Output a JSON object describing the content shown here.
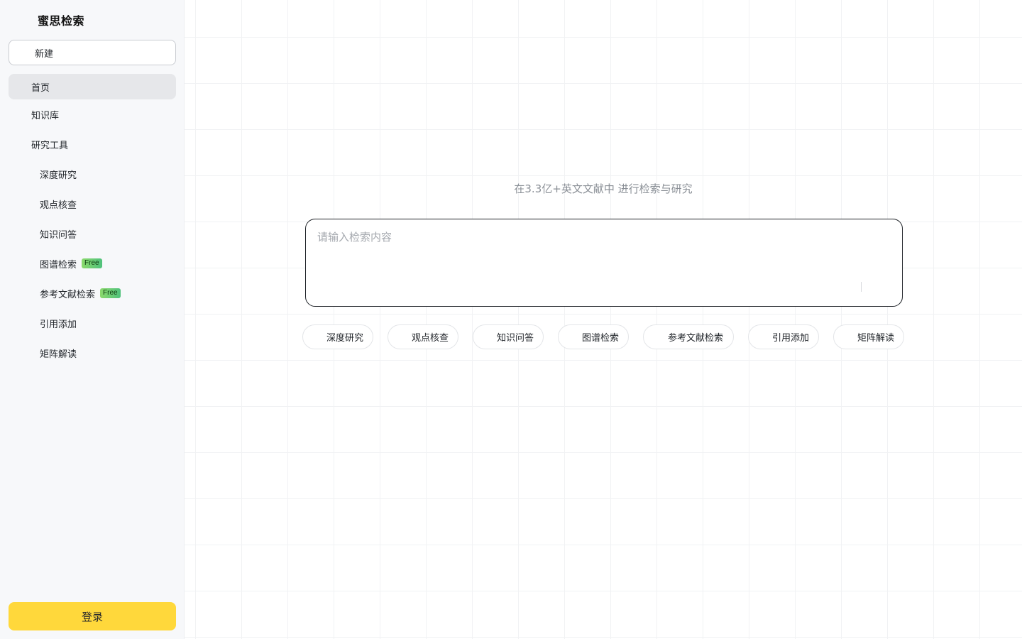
{
  "sidebar": {
    "brand": "蜜思检索",
    "new_label": "新建",
    "items": [
      {
        "label": "首页"
      },
      {
        "label": "知识库"
      },
      {
        "label": "研究工具"
      },
      {
        "label": "深度研究"
      },
      {
        "label": "观点核查"
      },
      {
        "label": "知识问答"
      },
      {
        "label": "图谱检索",
        "badge": "Free"
      },
      {
        "label": "参考文献检索",
        "badge": "Free"
      },
      {
        "label": "引用添加"
      },
      {
        "label": "矩阵解读"
      }
    ],
    "login_label": "登录"
  },
  "main": {
    "subtitle": "在3.3亿+英文文献中 进行检索与研究",
    "search_placeholder": "请输入检索内容",
    "chips": [
      {
        "label": "深度研究"
      },
      {
        "label": "观点核查"
      },
      {
        "label": "知识问答"
      },
      {
        "label": "图谱检索"
      },
      {
        "label": "参考文献检索"
      },
      {
        "label": "引用添加"
      },
      {
        "label": "矩阵解读"
      }
    ]
  },
  "colors": {
    "sidebar_bg": "#f7f8fa",
    "active_item_bg": "#e6e7ea",
    "login_button": "#ffd83b",
    "free_badge": "#6bcf73"
  }
}
